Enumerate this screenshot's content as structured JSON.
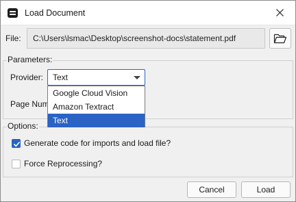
{
  "window": {
    "title": "Load Document",
    "app_icon": "document-icon",
    "close_icon": "close-icon"
  },
  "file": {
    "label": "File:",
    "path": "C:\\Users\\lsmac\\Desktop\\screenshot-docs\\statement.pdf",
    "browse_icon": "folder-open-icon"
  },
  "parameters": {
    "group_label": "Parameters:",
    "provider_label": "Provider:",
    "provider_value": "Text",
    "provider_options": [
      "Google Cloud Vision",
      "Amazon Textract",
      "Text"
    ],
    "provider_selected_index": 2,
    "page_number_label": "Page Num"
  },
  "options": {
    "group_label": "Options:",
    "generate_code": {
      "label": "Generate code for imports and load file?",
      "checked": true
    },
    "force_reprocessing": {
      "label": "Force Reprocessing?",
      "checked": false
    }
  },
  "buttons": {
    "cancel": "Cancel",
    "load": "Load"
  },
  "colors": {
    "accent": "#2b63c4",
    "window_bg": "#f0f0f0"
  }
}
